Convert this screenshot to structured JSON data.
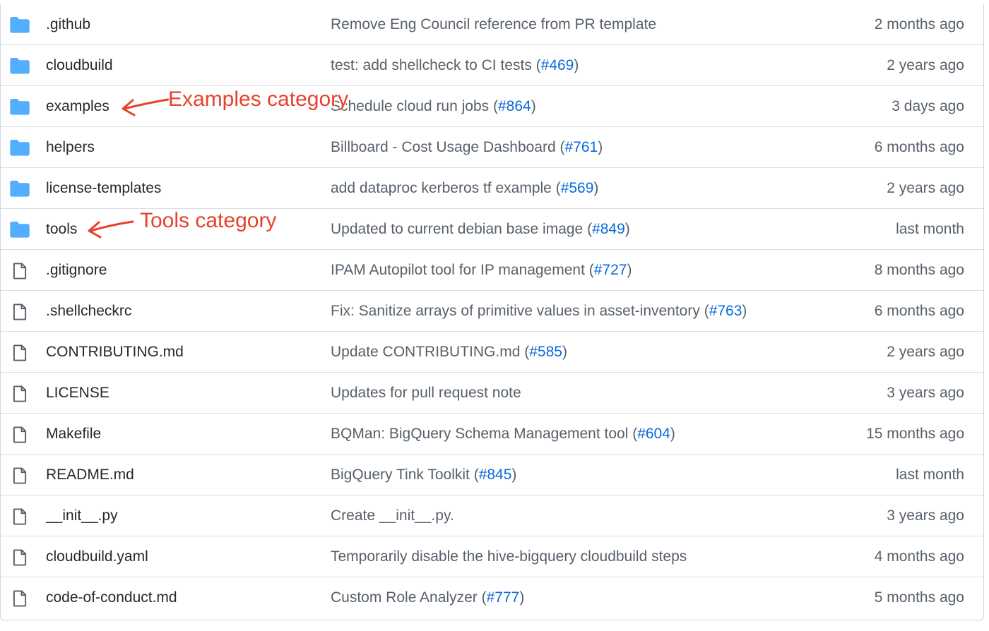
{
  "colors": {
    "folder_icon": "#54aeff",
    "file_icon": "#57606a",
    "link": "#0969da",
    "text": "#24292f",
    "muted": "#57606a",
    "border": "#d8dee4",
    "annotation": "#e8412b"
  },
  "files": [
    {
      "type": "folder",
      "icon": "folder-icon",
      "name": ".github",
      "commit_text": "Remove Eng Council reference from PR template",
      "pr": "",
      "commit_suffix": "",
      "age": "2 months ago"
    },
    {
      "type": "folder",
      "icon": "folder-icon",
      "name": "cloudbuild",
      "commit_text": "test: add shellcheck to CI tests (",
      "pr": "#469",
      "commit_suffix": ")",
      "age": "2 years ago"
    },
    {
      "type": "folder",
      "icon": "folder-icon",
      "name": "examples",
      "commit_text": "Schedule cloud run jobs (",
      "pr": "#864",
      "commit_suffix": ")",
      "age": "3 days ago"
    },
    {
      "type": "folder",
      "icon": "folder-icon",
      "name": "helpers",
      "commit_text": "Billboard - Cost Usage Dashboard (",
      "pr": "#761",
      "commit_suffix": ")",
      "age": "6 months ago"
    },
    {
      "type": "folder",
      "icon": "folder-icon",
      "name": "license-templates",
      "commit_text": "add dataproc kerberos tf example (",
      "pr": "#569",
      "commit_suffix": ")",
      "age": "2 years ago"
    },
    {
      "type": "folder",
      "icon": "folder-icon",
      "name": "tools",
      "commit_text": "Updated to current debian base image (",
      "pr": "#849",
      "commit_suffix": ")",
      "age": "last month"
    },
    {
      "type": "file",
      "icon": "file-icon",
      "name": ".gitignore",
      "commit_text": "IPAM Autopilot tool for IP management (",
      "pr": "#727",
      "commit_suffix": ")",
      "age": "8 months ago"
    },
    {
      "type": "file",
      "icon": "file-icon",
      "name": ".shellcheckrc",
      "commit_text": "Fix: Sanitize arrays of primitive values in asset-inventory (",
      "pr": "#763",
      "commit_suffix": ")",
      "age": "6 months ago"
    },
    {
      "type": "file",
      "icon": "file-icon",
      "name": "CONTRIBUTING.md",
      "commit_text": "Update CONTRIBUTING.md (",
      "pr": "#585",
      "commit_suffix": ")",
      "age": "2 years ago"
    },
    {
      "type": "file",
      "icon": "file-icon",
      "name": "LICENSE",
      "commit_text": "Updates for pull request note",
      "pr": "",
      "commit_suffix": "",
      "age": "3 years ago"
    },
    {
      "type": "file",
      "icon": "file-icon",
      "name": "Makefile",
      "commit_text": "BQMan: BigQuery Schema Management tool (",
      "pr": "#604",
      "commit_suffix": ")",
      "age": "15 months ago"
    },
    {
      "type": "file",
      "icon": "file-icon",
      "name": "README.md",
      "commit_text": "BigQuery Tink Toolkit (",
      "pr": "#845",
      "commit_suffix": ")",
      "age": "last month"
    },
    {
      "type": "file",
      "icon": "file-icon",
      "name": "__init__.py",
      "commit_text": "Create __init__.py.",
      "pr": "",
      "commit_suffix": "",
      "age": "3 years ago"
    },
    {
      "type": "file",
      "icon": "file-icon",
      "name": "cloudbuild.yaml",
      "commit_text": "Temporarily disable the hive-bigquery cloudbuild steps",
      "pr": "",
      "commit_suffix": "",
      "age": "4 months ago"
    },
    {
      "type": "file",
      "icon": "file-icon",
      "name": "code-of-conduct.md",
      "commit_text": "Custom Role Analyzer (",
      "pr": "#777",
      "commit_suffix": ")",
      "age": "5 months ago"
    }
  ],
  "annotations": {
    "examples_label": "Examples category",
    "tools_label": "Tools category"
  }
}
